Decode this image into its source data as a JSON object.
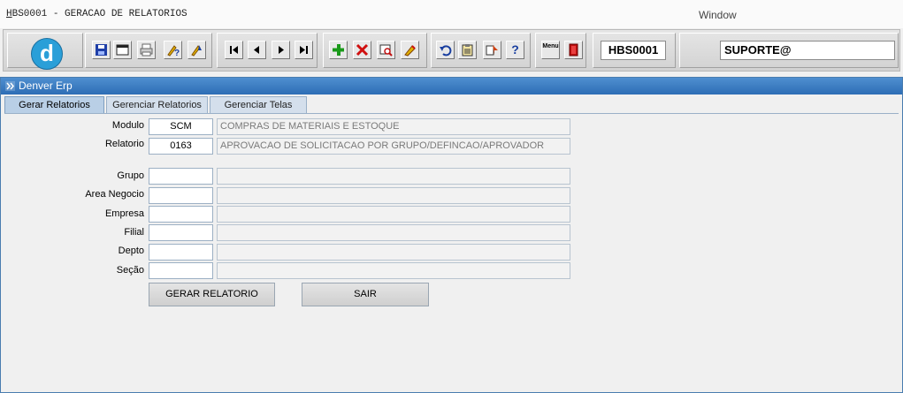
{
  "titlebar": {
    "title_first": "H",
    "title_rest": "BS0001 - GERACAO DE RELATORIOS",
    "window_menu": "Window"
  },
  "toolbar": {
    "icons": [
      "save-icon",
      "window-icon",
      "print-icon",
      "help-query-icon",
      "query-icon",
      "first-record-icon",
      "previous-record-icon",
      "next-record-icon",
      "last-record-icon",
      "insert-record-icon",
      "delete-record-icon",
      "search-record-icon",
      "edit-icon",
      "undo-icon",
      "clipboard-icon",
      "list-icon",
      "help-icon",
      "menu-icon",
      "exit-icon"
    ],
    "help_glyph": "?",
    "menu_glyph": "Menu",
    "form_code": "HBS0001",
    "user": "SUPORTE@"
  },
  "window": {
    "title": "Denver Erp"
  },
  "tabs": [
    {
      "label": "Gerar Relatorios",
      "active": true
    },
    {
      "label": "Gerenciar Relatorios",
      "active": false
    },
    {
      "label": "Gerenciar Telas",
      "active": false
    }
  ],
  "form": {
    "modulo": {
      "label": "Modulo",
      "code": "SCM",
      "desc": "COMPRAS DE MATERIAIS E ESTOQUE"
    },
    "relatorio": {
      "label": "Relatorio",
      "code": "0163",
      "desc": "APROVACAO DE SOLICITACAO POR GRUPO/DEFINCAO/APROVADOR"
    },
    "grupo": {
      "label": "Grupo",
      "code": "",
      "desc": ""
    },
    "area_negocio": {
      "label": "Area Negocio",
      "code": "",
      "desc": ""
    },
    "empresa": {
      "label": "Empresa",
      "code": "",
      "desc": ""
    },
    "filial": {
      "label": "Filial",
      "code": "",
      "desc": ""
    },
    "depto": {
      "label": "Depto",
      "code": "",
      "desc": ""
    },
    "secao": {
      "label": "Seção",
      "code": "",
      "desc": ""
    }
  },
  "buttons": {
    "gerar": "GERAR RELATORIO",
    "sair": "SAIR"
  },
  "colors": {
    "window_header": "#2d6db5",
    "logo": "#2a9fd8"
  }
}
